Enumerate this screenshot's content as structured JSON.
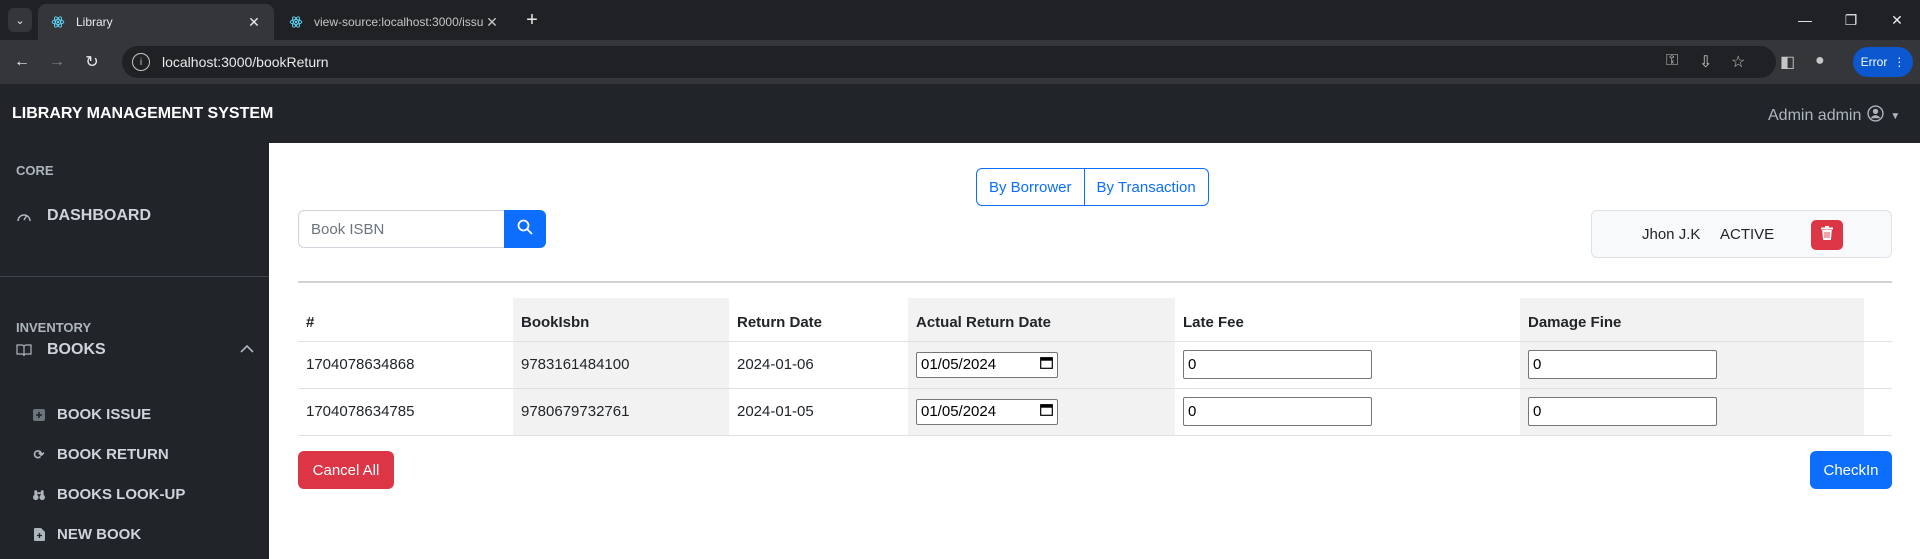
{
  "browser": {
    "tabs": [
      {
        "title": "Library",
        "active": true
      },
      {
        "title": "view-source:localhost:3000/issu",
        "active": false
      }
    ],
    "url": "localhost:3000/bookReturn",
    "profile_label": "Error"
  },
  "app": {
    "brand": "LIBRARY MANAGEMENT SYSTEM",
    "user": "Admin admin"
  },
  "sidebar": {
    "core_heading": "CORE",
    "dashboard": "DASHBOARD",
    "inventory_heading": "INVENTORY",
    "books": "BOOKS",
    "items": [
      {
        "label": "BOOK ISSUE",
        "icon": "plus-square-icon"
      },
      {
        "label": "BOOK RETURN",
        "icon": "refresh-icon"
      },
      {
        "label": "BOOKS LOOK-UP",
        "icon": "binoculars-icon"
      },
      {
        "label": "NEW BOOK",
        "icon": "file-plus-icon"
      }
    ]
  },
  "main": {
    "toggle": {
      "by_borrower": "By Borrower",
      "by_transaction": "By Transaction"
    },
    "search_placeholder": "Book ISBN",
    "borrower": {
      "name": "Jhon J.K",
      "status": "ACTIVE"
    },
    "table": {
      "headers": [
        "#",
        "BookIsbn",
        "Return Date",
        "Actual Return Date",
        "Late Fee",
        "Damage Fine"
      ],
      "rows": [
        {
          "id": "1704078634868",
          "isbn": "9783161484100",
          "return_date": "2024-01-06",
          "actual_return": "01/05/2024",
          "late_fee": "0",
          "damage_fine": "0"
        },
        {
          "id": "1704078634785",
          "isbn": "9780679732761",
          "return_date": "2024-01-05",
          "actual_return": "01/05/2024",
          "late_fee": "0",
          "damage_fine": "0"
        }
      ]
    },
    "cancel_all": "Cancel All",
    "checkin": "CheckIn"
  },
  "colors": {
    "primary": "#0d6efd",
    "danger": "#dc3545",
    "dark": "#212529"
  }
}
